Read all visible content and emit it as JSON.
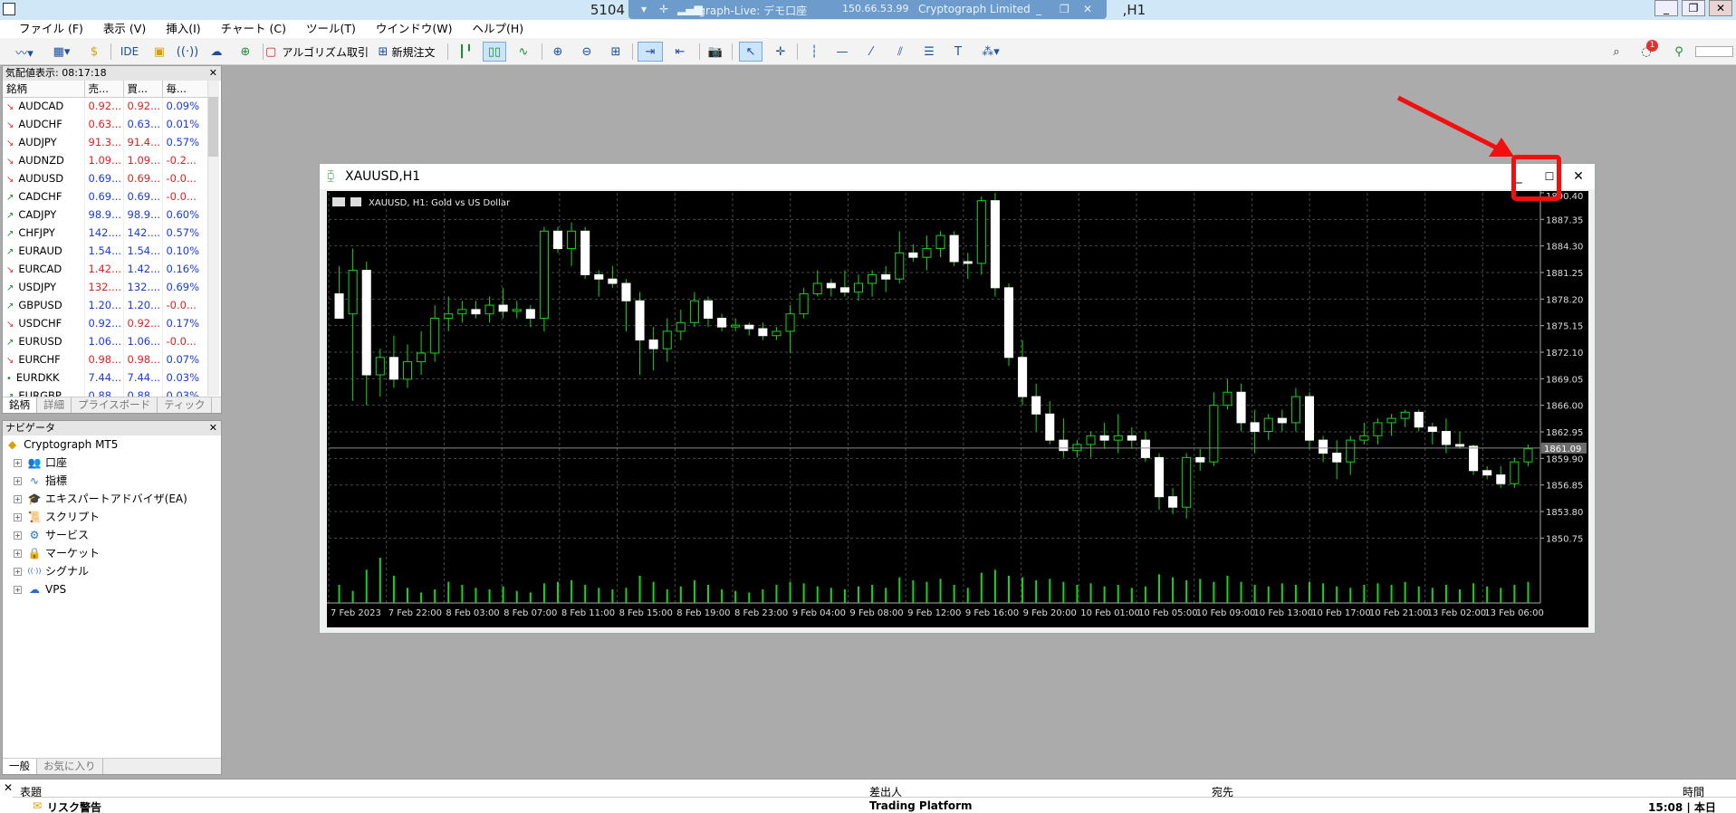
{
  "window": {
    "title_left": "5104",
    "title_right": "Cryptograph Limited",
    "title_suffix": ",H1",
    "rdp_server": "ograph-Live: デモ口座",
    "rdp_ip": "150.66.53.99"
  },
  "menu": [
    "ファイル (F)",
    "表示 (V)",
    "挿入(I)",
    "チャート (C)",
    "ツール(T)",
    "ウインドウ(W)",
    "ヘルプ(H)"
  ],
  "toolbar": {
    "ide": "IDE",
    "algo_trading": "アルゴリズム取引",
    "new_order": "新規注文",
    "notification_count": "1"
  },
  "market_watch": {
    "header": "気配値表示: 08:17:18",
    "columns": [
      "銘柄",
      "売...",
      "買...",
      "毎..."
    ],
    "rows": [
      {
        "symbol": "AUDCAD",
        "dir": "down",
        "bid": "0.92...",
        "ask": "0.92...",
        "change": "0.09%",
        "bid_color": "dn",
        "ask_color": "dn",
        "change_color": "up"
      },
      {
        "symbol": "AUDCHF",
        "dir": "down",
        "bid": "0.63...",
        "ask": "0.63...",
        "change": "0.01%",
        "bid_color": "dn",
        "ask_color": "up",
        "change_color": "up"
      },
      {
        "symbol": "AUDJPY",
        "dir": "down",
        "bid": "91.3...",
        "ask": "91.4...",
        "change": "0.57%",
        "bid_color": "dn",
        "ask_color": "dn",
        "change_color": "up"
      },
      {
        "symbol": "AUDNZD",
        "dir": "down",
        "bid": "1.09...",
        "ask": "1.09...",
        "change": "-0.2...",
        "bid_color": "dn",
        "ask_color": "dn",
        "change_color": "dn"
      },
      {
        "symbol": "AUDUSD",
        "dir": "down",
        "bid": "0.69...",
        "ask": "0.69...",
        "change": "-0.0...",
        "bid_color": "up",
        "ask_color": "dn",
        "change_color": "dn"
      },
      {
        "symbol": "CADCHF",
        "dir": "up",
        "bid": "0.69...",
        "ask": "0.69...",
        "change": "-0.0...",
        "bid_color": "up",
        "ask_color": "up",
        "change_color": "dn"
      },
      {
        "symbol": "CADJPY",
        "dir": "up",
        "bid": "98.9...",
        "ask": "98.9...",
        "change": "0.60%",
        "bid_color": "up",
        "ask_color": "up",
        "change_color": "up"
      },
      {
        "symbol": "CHFJPY",
        "dir": "up",
        "bid": "142....",
        "ask": "142....",
        "change": "0.57%",
        "bid_color": "up",
        "ask_color": "up",
        "change_color": "up"
      },
      {
        "symbol": "EURAUD",
        "dir": "up",
        "bid": "1.54...",
        "ask": "1.54...",
        "change": "0.10%",
        "bid_color": "up",
        "ask_color": "up",
        "change_color": "up"
      },
      {
        "symbol": "EURCAD",
        "dir": "down",
        "bid": "1.42...",
        "ask": "1.42...",
        "change": "0.16%",
        "bid_color": "dn",
        "ask_color": "up",
        "change_color": "up"
      },
      {
        "symbol": "USDJPY",
        "dir": "up",
        "bid": "132....",
        "ask": "132....",
        "change": "0.69%",
        "bid_color": "dn",
        "ask_color": "up",
        "change_color": "up"
      },
      {
        "symbol": "GBPUSD",
        "dir": "up",
        "bid": "1.20...",
        "ask": "1.20...",
        "change": "-0.0...",
        "bid_color": "up",
        "ask_color": "up",
        "change_color": "dn"
      },
      {
        "symbol": "USDCHF",
        "dir": "down",
        "bid": "0.92...",
        "ask": "0.92...",
        "change": "0.17%",
        "bid_color": "up",
        "ask_color": "dn",
        "change_color": "up"
      },
      {
        "symbol": "EURUSD",
        "dir": "up",
        "bid": "1.06...",
        "ask": "1.06...",
        "change": "-0.0...",
        "bid_color": "up",
        "ask_color": "up",
        "change_color": "dn"
      },
      {
        "symbol": "EURCHF",
        "dir": "down",
        "bid": "0.98...",
        "ask": "0.98...",
        "change": "0.07%",
        "bid_color": "dn",
        "ask_color": "dn",
        "change_color": "up"
      },
      {
        "symbol": "EURDKK",
        "dir": "flat",
        "bid": "7.44...",
        "ask": "7.44...",
        "change": "0.03%",
        "bid_color": "up",
        "ask_color": "up",
        "change_color": "up"
      },
      {
        "symbol": "EURGBP",
        "dir": "up",
        "bid": "0.88...",
        "ask": "0.88...",
        "change": "0.03%",
        "bid_color": "up",
        "ask_color": "up",
        "change_color": "up"
      }
    ],
    "tabs": [
      "銘柄",
      "詳細",
      "プライスボード",
      "ティック"
    ]
  },
  "navigator": {
    "header": "ナビゲータ",
    "root": "Cryptograph MT5",
    "items": [
      {
        "label": "口座",
        "icon": "accounts-icon"
      },
      {
        "label": "指標",
        "icon": "indicators-icon"
      },
      {
        "label": "エキスパートアドバイザ(EA)",
        "icon": "expert-advisors-icon"
      },
      {
        "label": "スクリプト",
        "icon": "scripts-icon"
      },
      {
        "label": "サービス",
        "icon": "services-icon"
      },
      {
        "label": "マーケット",
        "icon": "market-icon"
      },
      {
        "label": "シグナル",
        "icon": "signals-icon"
      },
      {
        "label": "VPS",
        "icon": "vps-icon"
      }
    ],
    "tabs": [
      "一般",
      "お気に入り"
    ]
  },
  "chart_window": {
    "title": "XAUUSD,H1",
    "chart_label": "XAUUSD, H1:  Gold vs US Dollar",
    "current_price": "1861.09"
  },
  "chart_data": {
    "type": "candlestick",
    "symbol": "XAUUSD",
    "timeframe": "H1",
    "yticks": [
      1850.75,
      1853.8,
      1856.85,
      1859.9,
      1862.95,
      1866.0,
      1869.05,
      1872.1,
      1875.15,
      1878.2,
      1881.25,
      1884.3,
      1887.35
    ],
    "ytick_labels": [
      "1850.75",
      "1853.80",
      "1856.85",
      "1859.90",
      "1862.95",
      "1866.00",
      "1869.05",
      "1872.10",
      "1875.15",
      "1878.20",
      "1881.25",
      "1884.30",
      "1887.35",
      "1890.40"
    ],
    "ylim": [
      1848.5,
      1890.4
    ],
    "xtick_labels": [
      "7 Feb 2023",
      "7 Feb 22:00",
      "8 Feb 03:00",
      "8 Feb 07:00",
      "8 Feb 11:00",
      "8 Feb 15:00",
      "8 Feb 19:00",
      "8 Feb 23:00",
      "9 Feb 04:00",
      "9 Feb 08:00",
      "9 Feb 12:00",
      "9 Feb 16:00",
      "9 Feb 20:00",
      "10 Feb 01:00",
      "10 Feb 05:00",
      "10 Feb 09:00",
      "10 Feb 13:00",
      "10 Feb 17:00",
      "10 Feb 21:00",
      "13 Feb 02:00",
      "13 Feb 06:00"
    ],
    "candles": [
      {
        "o": 1878.8,
        "h": 1882.0,
        "l": 1876.5,
        "c": 1876.0
      },
      {
        "o": 1876.5,
        "h": 1884.0,
        "l": 1866.5,
        "c": 1881.5
      },
      {
        "o": 1881.5,
        "h": 1882.5,
        "l": 1866.0,
        "c": 1869.5
      },
      {
        "o": 1869.5,
        "h": 1872.5,
        "l": 1867.0,
        "c": 1871.5
      },
      {
        "o": 1871.5,
        "h": 1874.0,
        "l": 1868.0,
        "c": 1869.0
      },
      {
        "o": 1869.0,
        "h": 1873.0,
        "l": 1868.0,
        "c": 1871.0
      },
      {
        "o": 1871.0,
        "h": 1874.5,
        "l": 1869.5,
        "c": 1872.0
      },
      {
        "o": 1872.0,
        "h": 1877.5,
        "l": 1871.0,
        "c": 1876.0
      },
      {
        "o": 1876.0,
        "h": 1878.5,
        "l": 1874.5,
        "c": 1876.5
      },
      {
        "o": 1876.5,
        "h": 1878.0,
        "l": 1875.5,
        "c": 1877.0
      },
      {
        "o": 1877.0,
        "h": 1878.0,
        "l": 1876.0,
        "c": 1876.5
      },
      {
        "o": 1876.5,
        "h": 1878.5,
        "l": 1875.5,
        "c": 1877.5
      },
      {
        "o": 1877.5,
        "h": 1879.5,
        "l": 1876.0,
        "c": 1876.8
      },
      {
        "o": 1876.8,
        "h": 1878.0,
        "l": 1876.0,
        "c": 1877.0
      },
      {
        "o": 1877.0,
        "h": 1877.5,
        "l": 1875.0,
        "c": 1876.0
      },
      {
        "o": 1876.0,
        "h": 1886.5,
        "l": 1874.5,
        "c": 1886.0
      },
      {
        "o": 1886.0,
        "h": 1886.5,
        "l": 1883.5,
        "c": 1884.0
      },
      {
        "o": 1884.0,
        "h": 1887.0,
        "l": 1882.0,
        "c": 1886.0
      },
      {
        "o": 1886.0,
        "h": 1886.5,
        "l": 1880.5,
        "c": 1881.0
      },
      {
        "o": 1881.0,
        "h": 1881.5,
        "l": 1878.5,
        "c": 1880.5
      },
      {
        "o": 1880.5,
        "h": 1882.0,
        "l": 1879.5,
        "c": 1880.0
      },
      {
        "o": 1880.0,
        "h": 1880.5,
        "l": 1874.5,
        "c": 1878.0
      },
      {
        "o": 1878.0,
        "h": 1879.0,
        "l": 1869.5,
        "c": 1873.5
      },
      {
        "o": 1873.5,
        "h": 1875.0,
        "l": 1870.0,
        "c": 1872.5
      },
      {
        "o": 1872.5,
        "h": 1876.0,
        "l": 1871.0,
        "c": 1874.5
      },
      {
        "o": 1874.5,
        "h": 1877.0,
        "l": 1873.5,
        "c": 1875.5
      },
      {
        "o": 1875.5,
        "h": 1879.0,
        "l": 1875.0,
        "c": 1878.0
      },
      {
        "o": 1878.0,
        "h": 1878.5,
        "l": 1875.0,
        "c": 1876.0
      },
      {
        "o": 1876.0,
        "h": 1876.5,
        "l": 1874.5,
        "c": 1875.0
      },
      {
        "o": 1875.0,
        "h": 1876.0,
        "l": 1874.5,
        "c": 1875.2
      },
      {
        "o": 1875.2,
        "h": 1875.5,
        "l": 1874.0,
        "c": 1874.8
      },
      {
        "o": 1874.8,
        "h": 1875.5,
        "l": 1873.5,
        "c": 1874.0
      },
      {
        "o": 1874.0,
        "h": 1875.0,
        "l": 1873.5,
        "c": 1874.5
      },
      {
        "o": 1874.5,
        "h": 1877.5,
        "l": 1872.0,
        "c": 1876.5
      },
      {
        "o": 1876.5,
        "h": 1879.5,
        "l": 1876.0,
        "c": 1878.8
      },
      {
        "o": 1878.8,
        "h": 1881.5,
        "l": 1878.5,
        "c": 1880.0
      },
      {
        "o": 1880.0,
        "h": 1880.5,
        "l": 1878.5,
        "c": 1879.5
      },
      {
        "o": 1879.5,
        "h": 1881.5,
        "l": 1878.5,
        "c": 1879.0
      },
      {
        "o": 1879.0,
        "h": 1881.0,
        "l": 1878.0,
        "c": 1880.0
      },
      {
        "o": 1880.0,
        "h": 1881.5,
        "l": 1878.5,
        "c": 1881.0
      },
      {
        "o": 1881.0,
        "h": 1882.0,
        "l": 1879.0,
        "c": 1880.5
      },
      {
        "o": 1880.5,
        "h": 1886.0,
        "l": 1880.0,
        "c": 1883.5
      },
      {
        "o": 1883.5,
        "h": 1884.5,
        "l": 1882.5,
        "c": 1883.0
      },
      {
        "o": 1883.0,
        "h": 1885.5,
        "l": 1881.5,
        "c": 1884.0
      },
      {
        "o": 1884.0,
        "h": 1886.0,
        "l": 1883.0,
        "c": 1885.5
      },
      {
        "o": 1885.5,
        "h": 1886.0,
        "l": 1882.0,
        "c": 1882.5
      },
      {
        "o": 1882.5,
        "h": 1883.5,
        "l": 1880.5,
        "c": 1882.3
      },
      {
        "o": 1882.3,
        "h": 1890.0,
        "l": 1881.0,
        "c": 1889.5
      },
      {
        "o": 1889.5,
        "h": 1890.4,
        "l": 1878.5,
        "c": 1879.5
      },
      {
        "o": 1879.5,
        "h": 1880.0,
        "l": 1870.5,
        "c": 1871.5
      },
      {
        "o": 1871.5,
        "h": 1873.5,
        "l": 1866.0,
        "c": 1867.0
      },
      {
        "o": 1867.0,
        "h": 1868.5,
        "l": 1863.0,
        "c": 1865.0
      },
      {
        "o": 1865.0,
        "h": 1866.5,
        "l": 1861.5,
        "c": 1862.0
      },
      {
        "o": 1862.0,
        "h": 1864.5,
        "l": 1860.0,
        "c": 1860.8
      },
      {
        "o": 1860.8,
        "h": 1862.0,
        "l": 1860.0,
        "c": 1861.5
      },
      {
        "o": 1861.5,
        "h": 1863.0,
        "l": 1860.0,
        "c": 1862.5
      },
      {
        "o": 1862.5,
        "h": 1864.0,
        "l": 1861.0,
        "c": 1862.0
      },
      {
        "o": 1862.0,
        "h": 1865.0,
        "l": 1860.5,
        "c": 1862.5
      },
      {
        "o": 1862.5,
        "h": 1863.5,
        "l": 1861.0,
        "c": 1862.0
      },
      {
        "o": 1862.0,
        "h": 1863.0,
        "l": 1859.5,
        "c": 1860.0
      },
      {
        "o": 1860.0,
        "h": 1860.5,
        "l": 1854.0,
        "c": 1855.5
      },
      {
        "o": 1855.5,
        "h": 1856.5,
        "l": 1853.5,
        "c": 1854.3
      },
      {
        "o": 1854.3,
        "h": 1860.5,
        "l": 1853.0,
        "c": 1860.0
      },
      {
        "o": 1860.0,
        "h": 1861.0,
        "l": 1858.5,
        "c": 1859.5
      },
      {
        "o": 1859.5,
        "h": 1867.5,
        "l": 1859.0,
        "c": 1866.0
      },
      {
        "o": 1866.0,
        "h": 1869.0,
        "l": 1865.5,
        "c": 1867.5
      },
      {
        "o": 1867.5,
        "h": 1868.5,
        "l": 1863.0,
        "c": 1864.0
      },
      {
        "o": 1864.0,
        "h": 1865.5,
        "l": 1860.5,
        "c": 1863.0
      },
      {
        "o": 1863.0,
        "h": 1865.0,
        "l": 1862.0,
        "c": 1864.5
      },
      {
        "o": 1864.5,
        "h": 1865.5,
        "l": 1863.0,
        "c": 1864.0
      },
      {
        "o": 1864.0,
        "h": 1868.0,
        "l": 1863.0,
        "c": 1867.0
      },
      {
        "o": 1867.0,
        "h": 1867.5,
        "l": 1861.0,
        "c": 1862.0
      },
      {
        "o": 1862.0,
        "h": 1862.5,
        "l": 1859.5,
        "c": 1860.5
      },
      {
        "o": 1860.5,
        "h": 1862.0,
        "l": 1857.5,
        "c": 1859.5
      },
      {
        "o": 1859.5,
        "h": 1862.5,
        "l": 1858.0,
        "c": 1862.0
      },
      {
        "o": 1862.0,
        "h": 1864.0,
        "l": 1861.5,
        "c": 1862.5
      },
      {
        "o": 1862.5,
        "h": 1864.5,
        "l": 1861.5,
        "c": 1864.0
      },
      {
        "o": 1864.0,
        "h": 1865.0,
        "l": 1862.5,
        "c": 1864.5
      },
      {
        "o": 1864.5,
        "h": 1865.5,
        "l": 1863.5,
        "c": 1865.2
      },
      {
        "o": 1865.2,
        "h": 1865.5,
        "l": 1863.0,
        "c": 1863.5
      },
      {
        "o": 1863.5,
        "h": 1864.0,
        "l": 1861.5,
        "c": 1863.0
      },
      {
        "o": 1863.0,
        "h": 1864.5,
        "l": 1860.5,
        "c": 1861.5
      },
      {
        "o": 1861.5,
        "h": 1863.0,
        "l": 1861.0,
        "c": 1861.3
      },
      {
        "o": 1861.3,
        "h": 1861.5,
        "l": 1858.0,
        "c": 1858.5
      },
      {
        "o": 1858.5,
        "h": 1859.0,
        "l": 1857.5,
        "c": 1858.0
      },
      {
        "o": 1858.0,
        "h": 1859.0,
        "l": 1856.5,
        "c": 1857.0
      },
      {
        "o": 1857.0,
        "h": 1860.0,
        "l": 1856.5,
        "c": 1859.5
      },
      {
        "o": 1859.5,
        "h": 1861.5,
        "l": 1859.0,
        "c": 1861.0
      }
    ],
    "volumes": [
      12,
      8,
      22,
      30,
      18,
      10,
      7,
      9,
      14,
      12,
      10,
      9,
      11,
      8,
      7,
      13,
      14,
      15,
      12,
      10,
      9,
      10,
      18,
      14,
      9,
      11,
      15,
      12,
      9,
      8,
      7,
      9,
      12,
      14,
      13,
      11,
      10,
      9,
      11,
      12,
      10,
      17,
      15,
      14,
      16,
      12,
      10,
      20,
      22,
      18,
      17,
      15,
      16,
      14,
      12,
      13,
      11,
      12,
      10,
      11,
      19,
      17,
      15,
      16,
      14,
      18,
      14,
      12,
      11,
      13,
      12,
      14,
      13,
      11,
      10,
      12,
      13,
      12,
      14,
      11,
      10,
      12,
      9,
      13,
      11,
      10,
      12,
      14
    ],
    "grid": true
  },
  "toolbox": {
    "columns": [
      "表題",
      "差出人",
      "宛先",
      "時間"
    ],
    "row": {
      "subject": "リスク警告",
      "from": "Trading Platform",
      "to": "",
      "time": "15:08 | 本日"
    }
  }
}
